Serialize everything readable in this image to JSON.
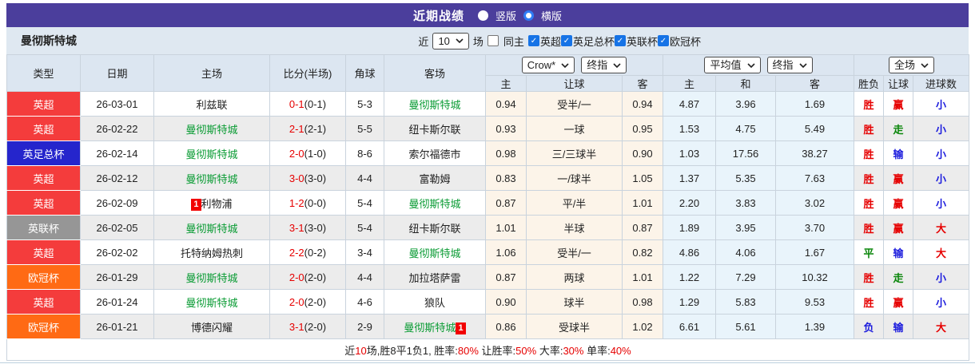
{
  "title_bar": {
    "title": "近期战绩",
    "vertical_label": "竖版",
    "horizontal_label": "横版",
    "selected": "横版"
  },
  "filter_bar": {
    "team": "曼彻斯特城",
    "recent_label": "近",
    "recent_count": "10",
    "matches_label": "场",
    "same_home_label": "同主",
    "same_home_checked": false,
    "league_filters": [
      {
        "label": "英超",
        "checked": true
      },
      {
        "label": "英足总杯",
        "checked": true
      },
      {
        "label": "英联杯",
        "checked": true
      },
      {
        "label": "欧冠杯",
        "checked": true
      }
    ]
  },
  "table": {
    "headers": {
      "left": [
        "类型",
        "日期",
        "主场",
        "比分(半场)",
        "角球",
        "客场"
      ],
      "group1": {
        "dropdowns": [
          "Crow*",
          "终指"
        ],
        "cols": [
          "主",
          "让球",
          "客"
        ]
      },
      "group2": {
        "dropdowns": [
          "平均值",
          "终指"
        ],
        "cols": [
          "主",
          "和",
          "客"
        ]
      },
      "group3": {
        "dropdowns": [
          "全场"
        ],
        "cols": [
          "胜负",
          "让球",
          "进球数"
        ]
      }
    },
    "rows": [
      {
        "league": "英超",
        "date": "26-03-01",
        "home": "利兹联",
        "home_highlight": false,
        "home_red_card": "",
        "score": "0-1",
        "half": "(0-1)",
        "corner": "5-3",
        "away": "曼彻斯特城",
        "away_highlight": true,
        "away_red_card": "",
        "odds1": [
          "0.94",
          "受半/一",
          "0.94"
        ],
        "odds2": [
          "4.87",
          "3.96",
          "1.69"
        ],
        "result": [
          "胜",
          "赢",
          "小"
        ]
      },
      {
        "league": "英超",
        "date": "26-02-22",
        "home": "曼彻斯特城",
        "home_highlight": true,
        "home_red_card": "",
        "score": "2-1",
        "half": "(2-1)",
        "corner": "5-5",
        "away": "纽卡斯尔联",
        "away_highlight": false,
        "away_red_card": "",
        "odds1": [
          "0.93",
          "一球",
          "0.95"
        ],
        "odds2": [
          "1.53",
          "4.75",
          "5.49"
        ],
        "result": [
          "胜",
          "走",
          "小"
        ]
      },
      {
        "league": "英足总杯",
        "date": "26-02-14",
        "home": "曼彻斯特城",
        "home_highlight": true,
        "home_red_card": "",
        "score": "2-0",
        "half": "(1-0)",
        "corner": "8-6",
        "away": "索尔福德市",
        "away_highlight": false,
        "away_red_card": "",
        "odds1": [
          "0.98",
          "三/三球半",
          "0.90"
        ],
        "odds2": [
          "1.03",
          "17.56",
          "38.27"
        ],
        "result": [
          "胜",
          "输",
          "小"
        ]
      },
      {
        "league": "英超",
        "date": "26-02-12",
        "home": "曼彻斯特城",
        "home_highlight": true,
        "home_red_card": "",
        "score": "3-0",
        "half": "(3-0)",
        "corner": "4-4",
        "away": "富勒姆",
        "away_highlight": false,
        "away_red_card": "",
        "odds1": [
          "0.83",
          "一/球半",
          "1.05"
        ],
        "odds2": [
          "1.37",
          "5.35",
          "7.63"
        ],
        "result": [
          "胜",
          "赢",
          "小"
        ]
      },
      {
        "league": "英超",
        "date": "26-02-09",
        "home": "利物浦",
        "home_highlight": false,
        "home_red_card": "1",
        "score": "1-2",
        "half": "(0-0)",
        "corner": "5-4",
        "away": "曼彻斯特城",
        "away_highlight": true,
        "away_red_card": "",
        "odds1": [
          "0.87",
          "平/半",
          "1.01"
        ],
        "odds2": [
          "2.20",
          "3.83",
          "3.02"
        ],
        "result": [
          "胜",
          "赢",
          "小"
        ]
      },
      {
        "league": "英联杯",
        "date": "26-02-05",
        "home": "曼彻斯特城",
        "home_highlight": true,
        "home_red_card": "",
        "score": "3-1",
        "half": "(3-0)",
        "corner": "5-4",
        "away": "纽卡斯尔联",
        "away_highlight": false,
        "away_red_card": "",
        "odds1": [
          "1.01",
          "半球",
          "0.87"
        ],
        "odds2": [
          "1.89",
          "3.95",
          "3.70"
        ],
        "result": [
          "胜",
          "赢",
          "大"
        ]
      },
      {
        "league": "英超",
        "date": "26-02-02",
        "home": "托特纳姆热刺",
        "home_highlight": false,
        "home_red_card": "",
        "score": "2-2",
        "half": "(0-2)",
        "corner": "3-4",
        "away": "曼彻斯特城",
        "away_highlight": true,
        "away_red_card": "",
        "odds1": [
          "1.06",
          "受半/一",
          "0.82"
        ],
        "odds2": [
          "4.86",
          "4.06",
          "1.67"
        ],
        "result": [
          "平",
          "输",
          "大"
        ]
      },
      {
        "league": "欧冠杯",
        "date": "26-01-29",
        "home": "曼彻斯特城",
        "home_highlight": true,
        "home_red_card": "",
        "score": "2-0",
        "half": "(2-0)",
        "corner": "4-4",
        "away": "加拉塔萨雷",
        "away_highlight": false,
        "away_red_card": "",
        "odds1": [
          "0.87",
          "两球",
          "1.01"
        ],
        "odds2": [
          "1.22",
          "7.29",
          "10.32"
        ],
        "result": [
          "胜",
          "走",
          "小"
        ]
      },
      {
        "league": "英超",
        "date": "26-01-24",
        "home": "曼彻斯特城",
        "home_highlight": true,
        "home_red_card": "",
        "score": "2-0",
        "half": "(2-0)",
        "corner": "4-6",
        "away": "狼队",
        "away_highlight": false,
        "away_red_card": "",
        "odds1": [
          "0.90",
          "球半",
          "0.98"
        ],
        "odds2": [
          "1.29",
          "5.83",
          "9.53"
        ],
        "result": [
          "胜",
          "赢",
          "小"
        ]
      },
      {
        "league": "欧冠杯",
        "date": "26-01-21",
        "home": "博德闪耀",
        "home_highlight": false,
        "home_red_card": "",
        "score": "3-1",
        "half": "(2-0)",
        "corner": "2-9",
        "away": "曼彻斯特城",
        "away_highlight": true,
        "away_red_card": "1",
        "odds1": [
          "0.86",
          "受球半",
          "1.02"
        ],
        "odds2": [
          "6.61",
          "5.61",
          "1.39"
        ],
        "result": [
          "负",
          "输",
          "大"
        ]
      }
    ]
  },
  "footer": {
    "segments": [
      {
        "text": "近",
        "red": false
      },
      {
        "text": "10",
        "red": true
      },
      {
        "text": "场,胜8平1负1, 胜率:",
        "red": false
      },
      {
        "text": "80%",
        "red": true
      },
      {
        "text": " 让胜率:",
        "red": false
      },
      {
        "text": "50%",
        "red": true
      },
      {
        "text": " 大率:",
        "red": false
      },
      {
        "text": "30%",
        "red": true
      },
      {
        "text": " 单率:",
        "red": false
      },
      {
        "text": "40%",
        "red": true
      }
    ]
  },
  "colors": {
    "title_bar_bg": "#4b3e9c",
    "radio_accent": "#2f7df6",
    "checkbox_accent": "#1673e6",
    "team_highlight": "#099b33",
    "score_red": "#e60000",
    "league": {
      "英超": "#f43c3c",
      "英足总杯": "#2525cc",
      "英联杯": "#969696",
      "欧冠杯": "#ff6a14"
    },
    "result": {
      "胜": "#e60000",
      "平": "#0a860a",
      "负": "#1c1cdd",
      "赢": "#e60000",
      "走": "#0a860a",
      "输": "#1c1cdd",
      "大": "#e60000",
      "小": "#1c1cdd"
    }
  }
}
